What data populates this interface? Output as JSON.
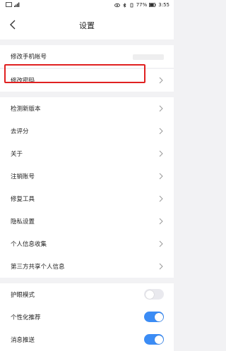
{
  "status": {
    "battery": "77%",
    "time": "3:55"
  },
  "header": {
    "title": "设置"
  },
  "settings": {
    "change_phone": "修改手机帐号",
    "change_password": "修改密码",
    "check_update": "检测新版本",
    "rate": "去评分",
    "about": "关于",
    "delete_account": "注销账号",
    "repair_tool": "修复工具",
    "privacy": "隐私设置",
    "personal_info": "个人信息收集",
    "third_party": "第三方共享个人信息"
  },
  "toggles": {
    "eye_mode": {
      "label": "护眼模式",
      "state": "off"
    },
    "personalized": {
      "label": "个性化推荐",
      "state": "on"
    },
    "push": {
      "label": "消息推送",
      "state": "on"
    }
  },
  "colors": {
    "accent": "#3b8cf5",
    "highlight": "#e02020"
  }
}
